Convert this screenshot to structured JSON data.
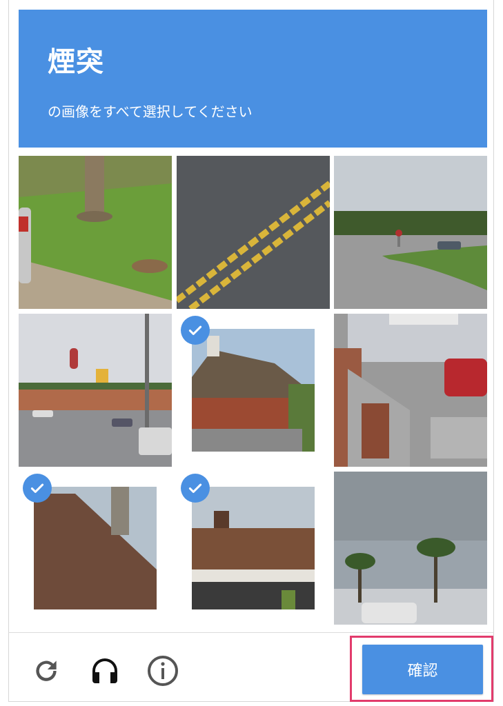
{
  "header": {
    "title": "煙突",
    "subtitle": "の画像をすべて選択してください"
  },
  "grid": {
    "tiles": [
      {
        "scene": "grass-tree-car",
        "selected": false
      },
      {
        "scene": "road-yellow-lines",
        "selected": false
      },
      {
        "scene": "street-curve-trees",
        "selected": false
      },
      {
        "scene": "commercial-street",
        "selected": false
      },
      {
        "scene": "house-roof-chimney",
        "selected": true
      },
      {
        "scene": "stairs-red-car",
        "selected": false
      },
      {
        "scene": "roof-chimney-closeup",
        "selected": true
      },
      {
        "scene": "roof-chimneys-house",
        "selected": true
      },
      {
        "scene": "palm-trees",
        "selected": false
      }
    ]
  },
  "footer": {
    "reload_icon": "reload-icon",
    "audio_icon": "headphones-icon",
    "info_icon": "info-icon",
    "verify_label": "確認"
  },
  "colors": {
    "accent": "#4a90e2",
    "highlight_outline": "#e23b6c"
  }
}
